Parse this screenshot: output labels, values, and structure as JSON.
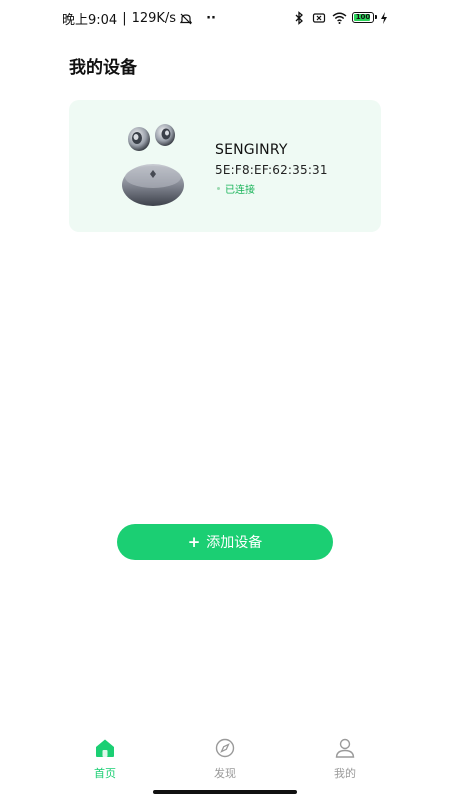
{
  "status_bar": {
    "time": "晚上9:04",
    "speed": "129K/s",
    "more": "··",
    "battery": "100"
  },
  "page": {
    "title": "我的设备"
  },
  "device": {
    "name": "SENGINRY",
    "mac": "5E:F8:EF:62:35:31",
    "status": "已连接"
  },
  "add_button": {
    "plus": "+",
    "label": "添加设备"
  },
  "nav": {
    "home": "首页",
    "discover": "发现",
    "me": "我的"
  },
  "colors": {
    "accent": "#1bcf73",
    "card_bg": "#effaf4",
    "inactive": "#9a9a9a"
  }
}
